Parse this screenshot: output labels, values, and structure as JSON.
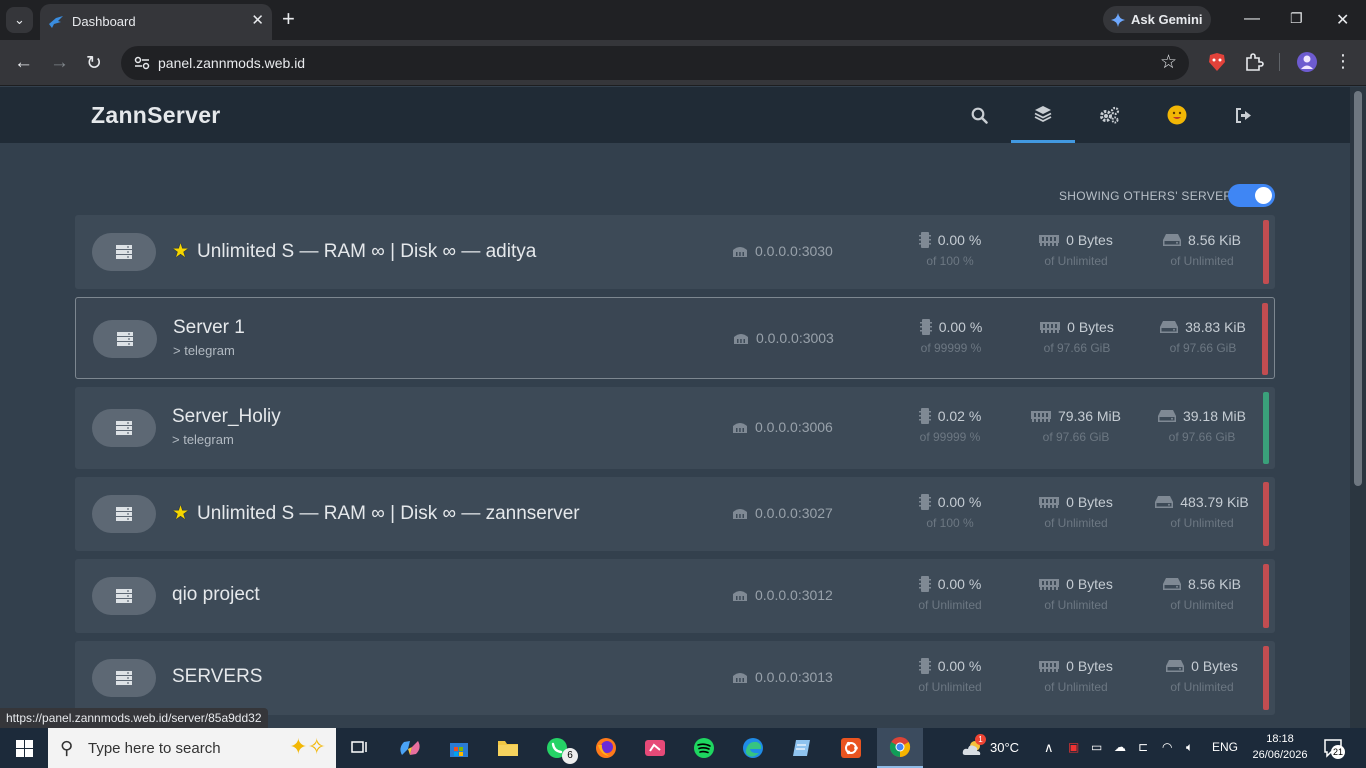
{
  "browser": {
    "tab_title": "Dashboard",
    "new_tab": "+",
    "gemini_label": "Ask Gemini",
    "url": "panel.zannmods.web.id",
    "status_url": "https://panel.zannmods.web.id/server/85a9dd32"
  },
  "app": {
    "brand": "ZannServer",
    "toggle_label": "SHOWING OTHERS' SERVERS",
    "toggle_on": true
  },
  "servers": [
    {
      "name": "Unlimited S — RAM ∞ | Disk ∞ — aditya",
      "starred": true,
      "desc": "",
      "allocation": "0.0.0.0:3030",
      "cpu": "0.00 %",
      "cpu_limit": "of 100 %",
      "mem": "0 Bytes",
      "mem_limit": "of Unlimited",
      "disk": "8.56 KiB",
      "disk_limit": "of Unlimited",
      "status_color": "#c24d51"
    },
    {
      "name": "Server 1",
      "starred": false,
      "desc": "> telegram",
      "allocation": "0.0.0.0:3003",
      "cpu": "0.00 %",
      "cpu_limit": "of 99999 %",
      "mem": "0 Bytes",
      "mem_limit": "of 97.66 GiB",
      "disk": "38.83 KiB",
      "disk_limit": "of 97.66 GiB",
      "status_color": "#c24d51"
    },
    {
      "name": "Server_Holiy",
      "starred": false,
      "desc": "> telegram",
      "allocation": "0.0.0.0:3006",
      "cpu": "0.02 %",
      "cpu_limit": "of 99999 %",
      "mem": "79.36 MiB",
      "mem_limit": "of 97.66 GiB",
      "disk": "39.18 MiB",
      "disk_limit": "of 97.66 GiB",
      "status_color": "#3aa07a"
    },
    {
      "name": "Unlimited S — RAM ∞ | Disk ∞ — zannserver",
      "starred": true,
      "desc": "",
      "allocation": "0.0.0.0:3027",
      "cpu": "0.00 %",
      "cpu_limit": "of 100 %",
      "mem": "0 Bytes",
      "mem_limit": "of Unlimited",
      "disk": "483.79 KiB",
      "disk_limit": "of Unlimited",
      "status_color": "#c24d51"
    },
    {
      "name": "qio project",
      "starred": false,
      "desc": "",
      "allocation": "0.0.0.0:3012",
      "cpu": "0.00 %",
      "cpu_limit": "of Unlimited",
      "mem": "0 Bytes",
      "mem_limit": "of Unlimited",
      "disk": "8.56 KiB",
      "disk_limit": "of Unlimited",
      "status_color": "#c24d51"
    },
    {
      "name": "SERVERS",
      "starred": false,
      "desc": "",
      "allocation": "0.0.0.0:3013",
      "cpu": "0.00 %",
      "cpu_limit": "of Unlimited",
      "mem": "0 Bytes",
      "mem_limit": "of Unlimited",
      "disk": "0 Bytes",
      "disk_limit": "of Unlimited",
      "status_color": "#c24d51"
    }
  ],
  "taskbar": {
    "search_placeholder": "Type here to search",
    "whatsapp_badge": "6",
    "weather": "30°C",
    "weather_badge": "1",
    "language": "ENG",
    "time": "18:18",
    "date": "26/06/2026",
    "notifications": "21"
  }
}
